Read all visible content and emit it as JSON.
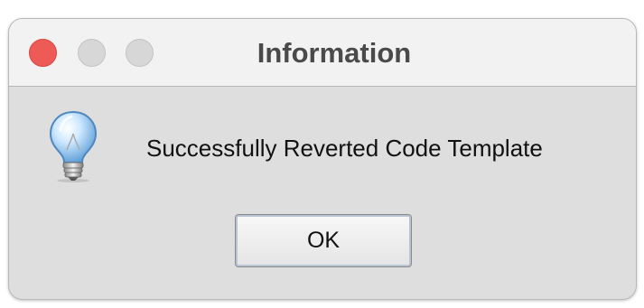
{
  "window": {
    "title": "Information",
    "controls": {
      "close_color": "#ee5b56",
      "minimize_color": "#d7d7d7",
      "maximize_color": "#d7d7d7"
    }
  },
  "dialog": {
    "icon": "lightbulb-icon",
    "message": "Successfully Reverted Code Template",
    "ok_label": "OK"
  }
}
